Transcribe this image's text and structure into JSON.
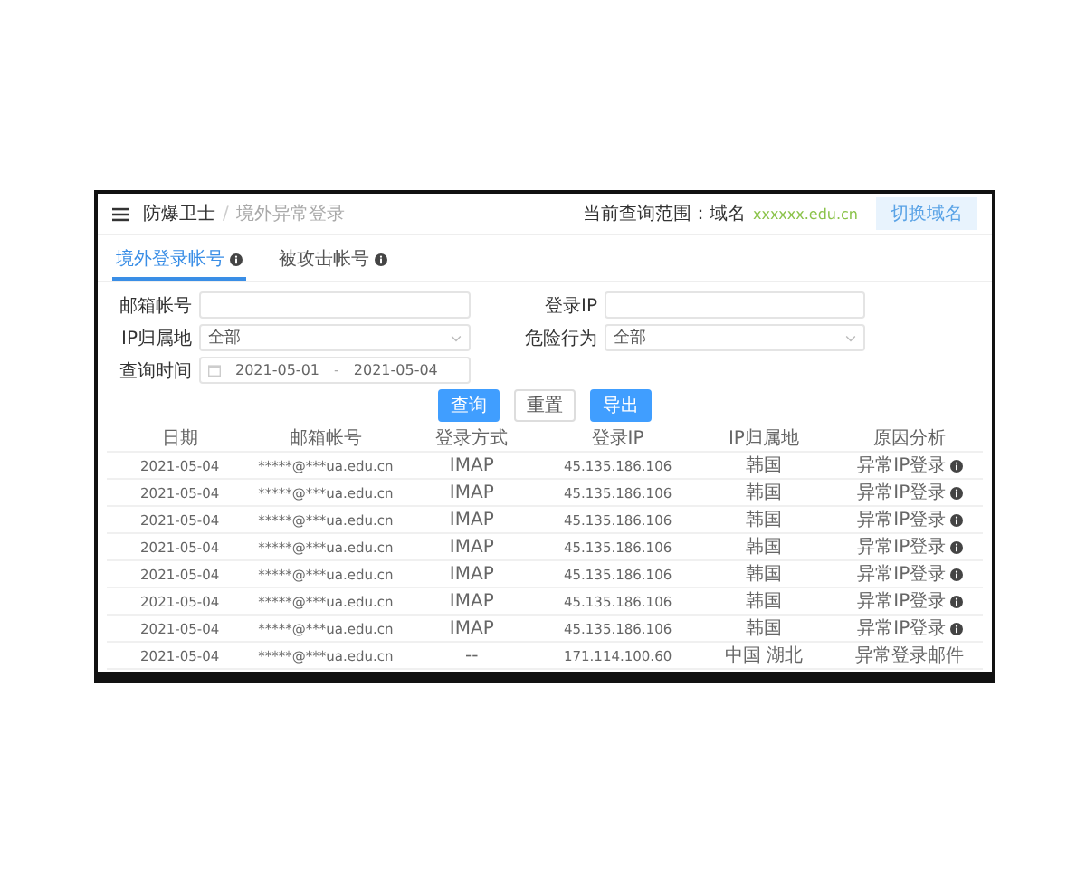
{
  "header": {
    "breadcrumb": [
      "防爆卫士",
      "境外异常登录"
    ],
    "separator": "/",
    "scope_label": "当前查询范围：域名",
    "scope_value": "xxxxxx.edu.cn",
    "switch_button": "切换域名"
  },
  "tabs": [
    {
      "label": "境外登录帐号",
      "selected": true
    },
    {
      "label": "被攻击帐号",
      "selected": false
    }
  ],
  "filters": [
    {
      "label": "邮箱帐号",
      "kind": "input"
    },
    {
      "label": "登录IP",
      "kind": "input"
    },
    {
      "label": "IP归属地",
      "kind": "select",
      "value": "全部"
    },
    {
      "label": "危险行为",
      "kind": "select",
      "value": "全部"
    },
    {
      "label": "查询时间",
      "kind": "daterange",
      "start": "2021-05-01",
      "separator": "-",
      "end": "2021-05-04"
    }
  ],
  "buttons": [
    {
      "label": "查询",
      "primary": true
    },
    {
      "label": "重置",
      "primary": false
    },
    {
      "label": "导出",
      "primary": true
    }
  ],
  "table": {
    "columns": [
      "日期",
      "邮箱帐号",
      "登录方式",
      "登录IP",
      "IP归属地",
      "原因分析"
    ],
    "rows": [
      {
        "cells": [
          "2021-05-04",
          "*****@***ua.edu.cn",
          "IMAP",
          "45.135.186.106",
          "韩国",
          "异常IP登录"
        ],
        "info": true
      },
      {
        "cells": [
          "2021-05-04",
          "*****@***ua.edu.cn",
          "IMAP",
          "45.135.186.106",
          "韩国",
          "异常IP登录"
        ],
        "info": true
      },
      {
        "cells": [
          "2021-05-04",
          "*****@***ua.edu.cn",
          "IMAP",
          "45.135.186.106",
          "韩国",
          "异常IP登录"
        ],
        "info": true
      },
      {
        "cells": [
          "2021-05-04",
          "*****@***ua.edu.cn",
          "IMAP",
          "45.135.186.106",
          "韩国",
          "异常IP登录"
        ],
        "info": true
      },
      {
        "cells": [
          "2021-05-04",
          "*****@***ua.edu.cn",
          "IMAP",
          "45.135.186.106",
          "韩国",
          "异常IP登录"
        ],
        "info": true
      },
      {
        "cells": [
          "2021-05-04",
          "*****@***ua.edu.cn",
          "IMAP",
          "45.135.186.106",
          "韩国",
          "异常IP登录"
        ],
        "info": true
      },
      {
        "cells": [
          "2021-05-04",
          "*****@***ua.edu.cn",
          "IMAP",
          "45.135.186.106",
          "韩国",
          "异常IP登录"
        ],
        "info": true
      },
      {
        "cells": [
          "2021-05-04",
          "*****@***ua.edu.cn",
          "--",
          "171.114.100.60",
          "中国 湖北",
          "异常登录邮件"
        ],
        "info": false
      }
    ]
  }
}
